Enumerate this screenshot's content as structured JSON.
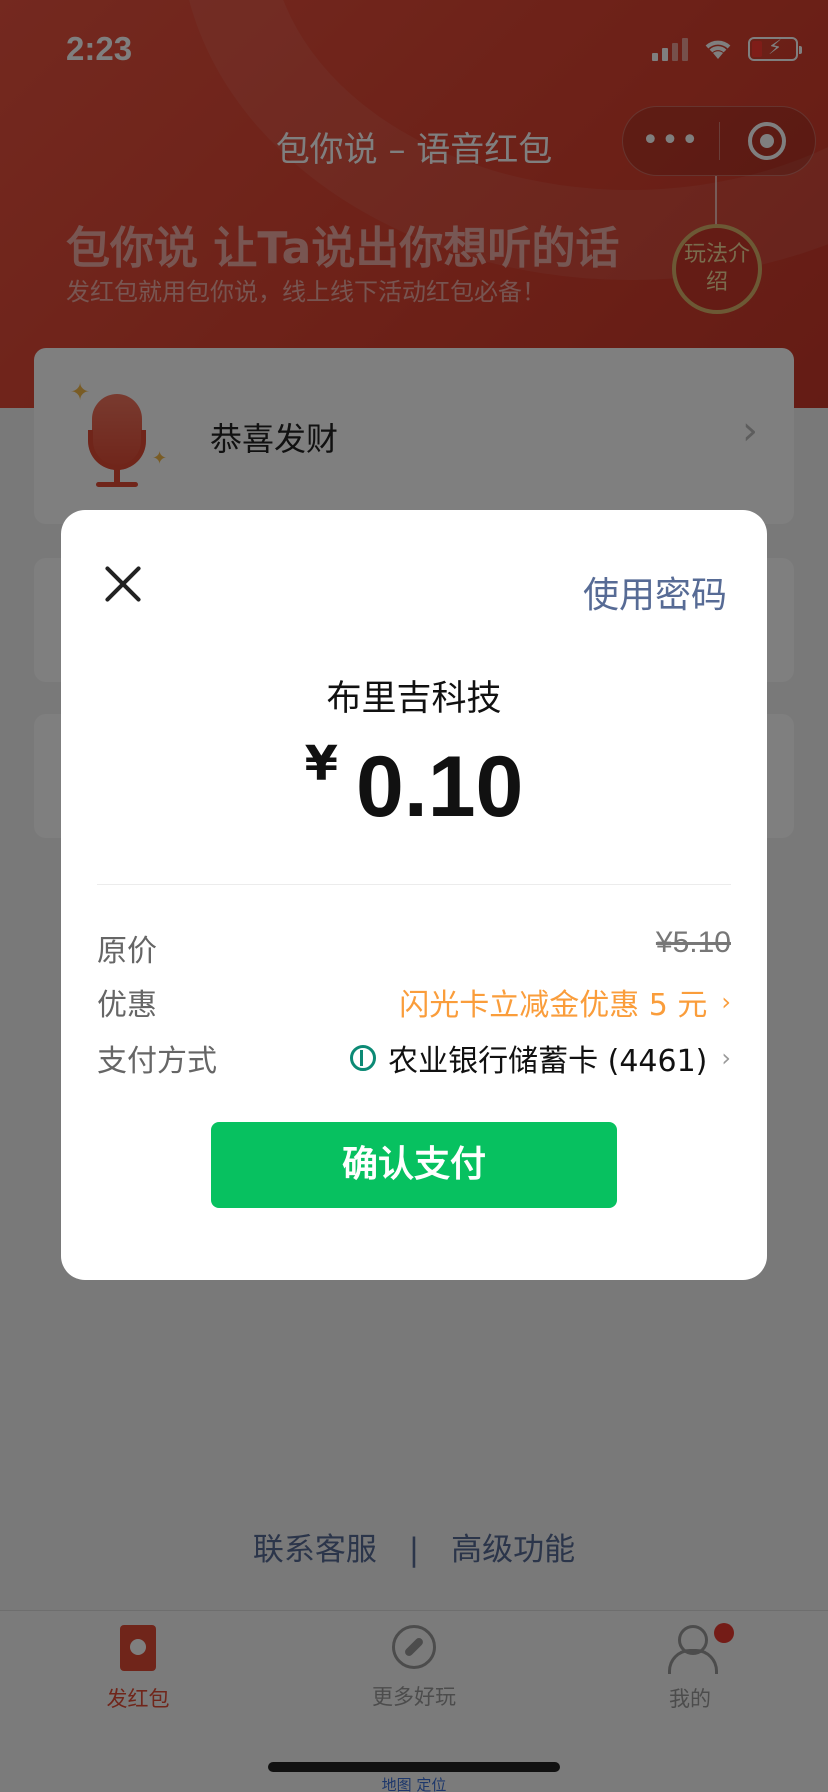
{
  "status_bar": {
    "time": "2:23"
  },
  "nav": {
    "title": "包你说 – 语音红包",
    "menu_icon": "more-dots-icon",
    "close_icon": "target-circle-icon"
  },
  "hero": {
    "slogan": "包你说 让Ta说出你想听的话",
    "subtitle": "发红包就用包你说，线上线下活动红包必备！",
    "rules_badge": "玩法介绍"
  },
  "cards": [
    {
      "title": "恭喜发财",
      "icon": "microphone-icon"
    }
  ],
  "footer": {
    "customer_service": "联系客服",
    "separator": "|",
    "advanced": "高级功能"
  },
  "tabbar": {
    "items": [
      {
        "label": "发红包",
        "icon": "hongbao-icon",
        "active": true
      },
      {
        "label": "更多好玩",
        "icon": "compass-icon",
        "active": false
      },
      {
        "label": "我的",
        "icon": "user-icon",
        "active": false,
        "badge_dot": true
      }
    ]
  },
  "bottom_hint": "地图 定位",
  "payment_dialog": {
    "use_password": "使用密码",
    "merchant": "布里吉科技",
    "currency": "¥",
    "amount": "0.10",
    "rows": {
      "original_price_label": "原价",
      "original_price_value": "¥5.10",
      "discount_label": "优惠",
      "discount_value": "闪光卡立减金优惠 5 元",
      "payment_method_label": "支付方式",
      "payment_method_value": "农业银行储蓄卡 (4461)"
    },
    "confirm_label": "确认支付"
  },
  "colors": {
    "hero_red": "#d9412f",
    "wechat_green": "#07c160",
    "link_blue": "#576b95",
    "discount_orange": "#fa9d3b"
  }
}
